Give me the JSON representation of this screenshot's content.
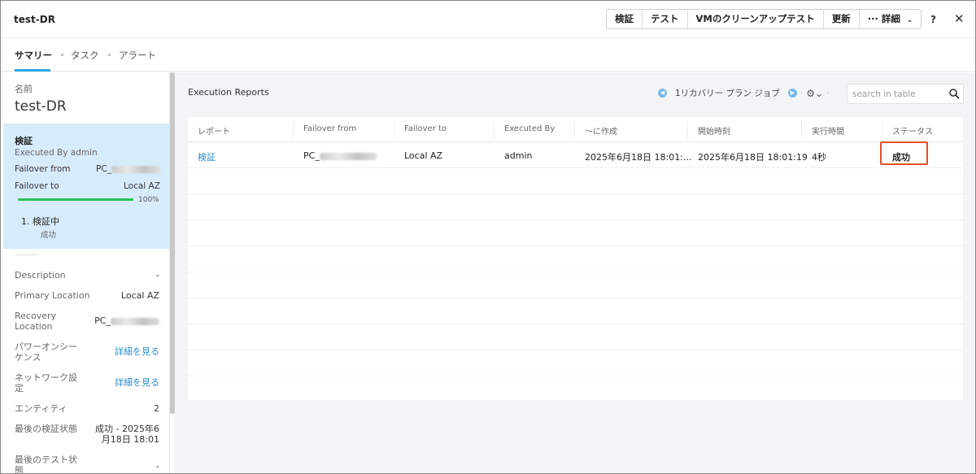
{
  "header": {
    "title": "test-DR",
    "actions": [
      "検証",
      "テスト",
      "VMのクリーンアップテスト",
      "更新"
    ],
    "more_label": "··· 詳細",
    "help_label": "?",
    "close_label": "✕"
  },
  "tabs": [
    {
      "label": "サマリー",
      "active": true
    },
    {
      "label": "タスク",
      "active": false
    },
    {
      "label": "アラート",
      "active": false
    }
  ],
  "sidebar": {
    "name_label": "名前",
    "name_value": "test-DR",
    "card": {
      "title": "検証",
      "executed_by": "Executed By admin",
      "failover_from_label": "Failover from",
      "failover_from_value": "PC_",
      "failover_to_label": "Failover to",
      "failover_to_value": "Local AZ",
      "progress_percent": 100,
      "progress_label": "100%",
      "step_name": "1. 検証中",
      "step_status": "成功"
    },
    "properties": [
      {
        "key": "Description",
        "value": "-"
      },
      {
        "key": "Primary Location",
        "value": "Local AZ"
      },
      {
        "key": "Recovery Location",
        "value": "PC_"
      },
      {
        "key": "パワーオンシーケンス",
        "value": "詳細を見る"
      },
      {
        "key": "ネットワーク設定",
        "value": "詳細を見る"
      },
      {
        "key": "エンティティ",
        "value": "2"
      },
      {
        "key": "最後の検証状態",
        "value": "成功 - 2025年6月18日 18:01"
      },
      {
        "key": "最後のテスト状態",
        "value": "-"
      }
    ]
  },
  "main": {
    "title": "Execution Reports",
    "pager_label": "1リカバリー プラン ジョブ",
    "search_placeholder": "search in table",
    "columns": [
      "レポート",
      "Failover from",
      "Failover to",
      "Executed By",
      "〜に作成",
      "開始時刻",
      "実行時間",
      "ステータス"
    ],
    "rows": [
      [
        "検証",
        "PC_",
        "Local AZ",
        "admin",
        "2025年6月18日 18:01:...",
        "2025年6月18日 18:01:19",
        "4秒",
        "成功"
      ]
    ]
  },
  "colors": {
    "accent": "#2da5e8",
    "link": "#2d8ed1",
    "card_bg": "#d7ecfa",
    "progress": "#26c253",
    "highlight": "#e0502a"
  }
}
